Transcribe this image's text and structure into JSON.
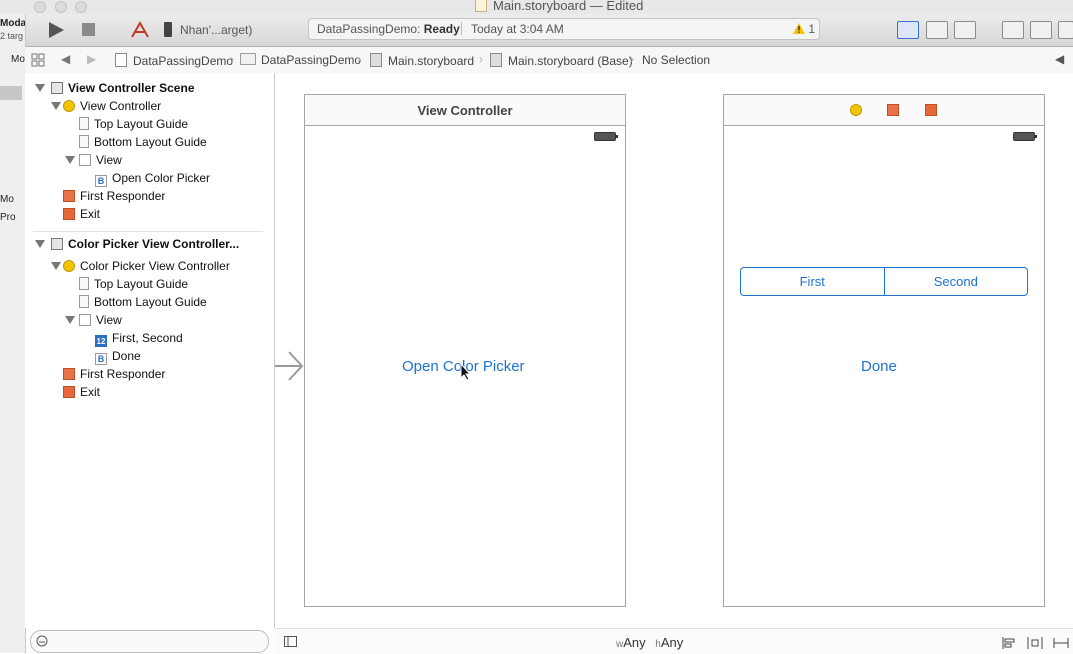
{
  "window": {
    "title": "Main.storyboard — Edited"
  },
  "toolbar": {
    "scheme": "Nhan'...arget)",
    "status_project": "DataPassingDemo:",
    "status_state": "Ready",
    "status_time": "Today at 3:04 AM",
    "warning_count": "1"
  },
  "jumpbar": {
    "crumbs": [
      "DataPassingDemo",
      "DataPassingDemo",
      "Main.storyboard",
      "Main.storyboard (Base)",
      "No Selection"
    ]
  },
  "leftstrip": {
    "items": [
      "Moda",
      "2 targ",
      "Mo",
      "Mo",
      "Pro"
    ]
  },
  "outline": {
    "items": [
      "View Controller Scene",
      "View Controller",
      "Top Layout Guide",
      "Bottom Layout Guide",
      "View",
      "Open Color Picker",
      "First Responder",
      "Exit",
      "Color Picker View Controller...",
      "Color Picker View Controller",
      "Top Layout Guide",
      "Bottom Layout Guide",
      "View",
      "First, Second",
      "Done",
      "First Responder",
      "Exit"
    ]
  },
  "canvas": {
    "scene1_title": "View Controller",
    "scene1_button": "Open Color Picker",
    "seg_first": "First",
    "seg_second": "Second",
    "scene2_button": "Done"
  },
  "bottombar": {
    "w_prefix": "w",
    "w_value": "Any",
    "h_prefix": "h",
    "h_value": "Any"
  },
  "colors": {
    "accent": "#1c73d0",
    "warning": "#f3c400",
    "exit": "#e5673a"
  }
}
